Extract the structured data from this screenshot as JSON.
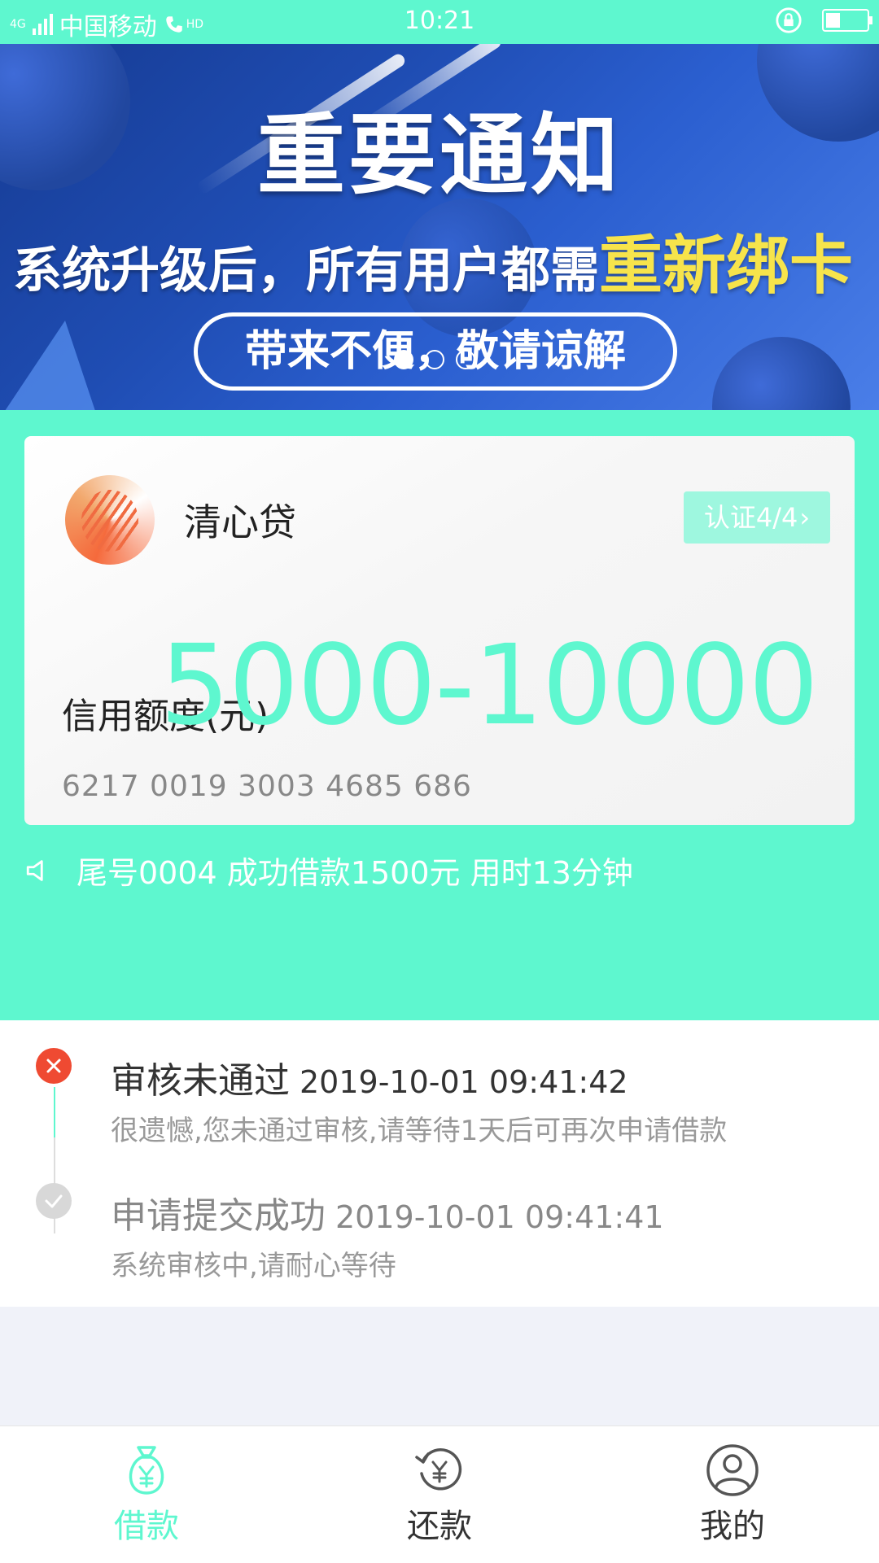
{
  "status_bar": {
    "network": "4G",
    "carrier": "中国移动",
    "hd": "HD",
    "time": "10:21",
    "battery_level": 0.35
  },
  "banner": {
    "title": "重要通知",
    "subtitle_prefix": "系统升级后，所有用户都需",
    "subtitle_highlight": "重新绑卡",
    "pill_text": "带来不便，敬请谅解",
    "page_count": 3,
    "active_page": 1
  },
  "loan_card": {
    "app_name": "清心贷",
    "cert_tag": "认证4/4",
    "credit_label": "信用额度(元)",
    "credit_value": "5000-10000",
    "card_number": "6217 0019 3003 4685 686"
  },
  "notice": {
    "text": "尾号0004 成功借款1500元 用时13分钟"
  },
  "timeline": [
    {
      "title": "审核未通过",
      "time": "2019-10-01 09:41:42",
      "desc": "很遗憾,您未通过审核,请等待1天后可再次申请借款"
    },
    {
      "title": "申请提交成功",
      "time": "2019-10-01 09:41:41",
      "desc": "系统审核中,请耐心等待"
    }
  ],
  "tabbar": [
    {
      "label": "借款",
      "icon": "money-bag-icon"
    },
    {
      "label": "还款",
      "icon": "refund-icon"
    },
    {
      "label": "我的",
      "icon": "user-icon"
    }
  ],
  "colors": {
    "accent": "#5ef7cf",
    "error": "#ef4a32",
    "highlight": "#f7e44b"
  }
}
